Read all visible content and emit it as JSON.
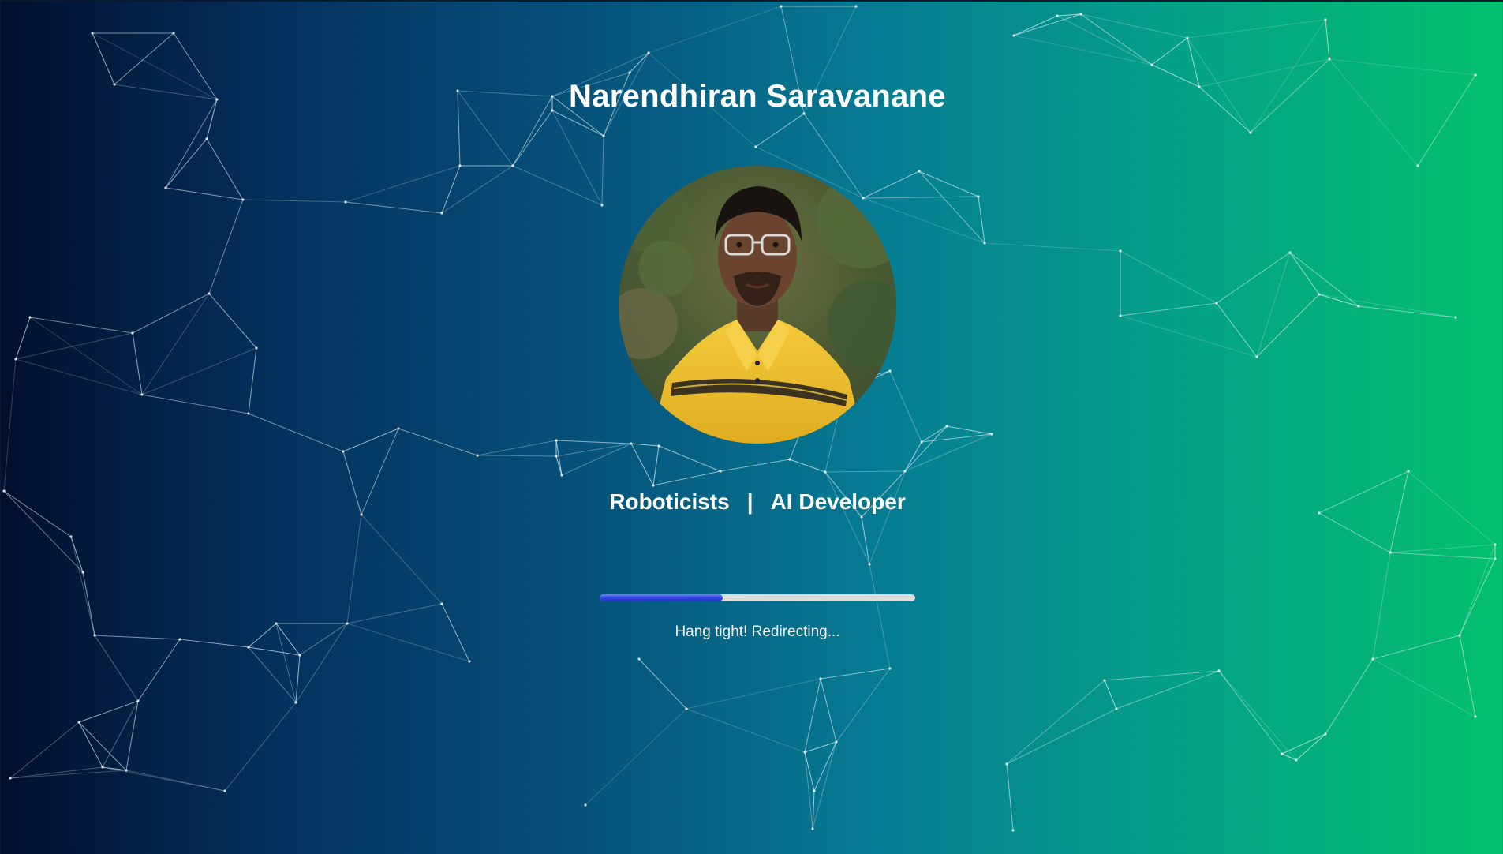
{
  "profile": {
    "name": "Narendhiran Saravanane",
    "roles": [
      "Roboticists",
      "AI Developer"
    ],
    "separator": "|",
    "avatar": "profile-photo"
  },
  "loader": {
    "progress": 0.39,
    "status": "Hang tight! Redirecting..."
  },
  "background": {
    "gradient": [
      "#020f2e",
      "#04305c",
      "#067b93",
      "#03c06e"
    ],
    "network_color": "#d8eef7"
  }
}
